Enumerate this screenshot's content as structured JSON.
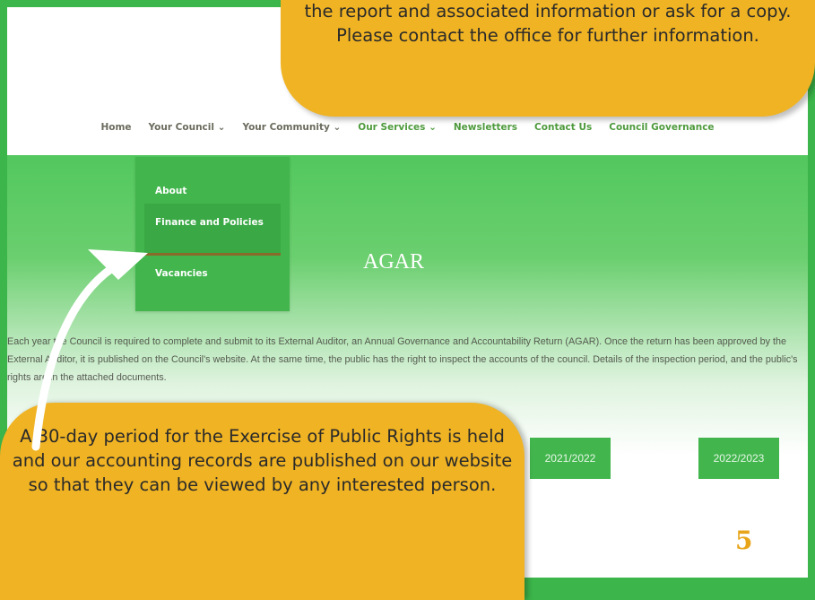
{
  "nav": {
    "items": [
      {
        "label": "Home"
      },
      {
        "label": "Your Council ⌄"
      },
      {
        "label": "Your Community ⌄"
      },
      {
        "label": "Our Services ⌄"
      },
      {
        "label": "Newsletters"
      },
      {
        "label": "Contact Us"
      },
      {
        "label": "Council Governance"
      }
    ]
  },
  "dropdown": {
    "items": [
      {
        "label": "About"
      },
      {
        "label": "Finance and Policies"
      },
      {
        "label": "Vacancies"
      }
    ]
  },
  "page": {
    "title": "AGAR",
    "body": "Each year the Council is required to complete and submit to its External Auditor, an Annual Governance and Accountability Return (AGAR). Once the return has been approved by the External Auditor, it is published on the Council's website. At the same time, the public has the right to inspect the accounts of the council. Details of the inspection period, and the public's rights are in the attached documents.",
    "buttons": [
      {
        "label": "2021/2022"
      },
      {
        "label": "2022/2023"
      }
    ]
  },
  "callouts": {
    "top": "the report and associated information or ask for a copy. Please contact the office for further information.",
    "bottom": "A 30-day period for the Exercise of Public Rights is held and our accounting records are published on our website so that they can be viewed by any interested person."
  },
  "page_number": "5",
  "colors": {
    "border_green": "#3cb54a",
    "banner_green": "#52c85d",
    "callout_yellow": "#f0b323",
    "page_number": "#e8a51a"
  }
}
